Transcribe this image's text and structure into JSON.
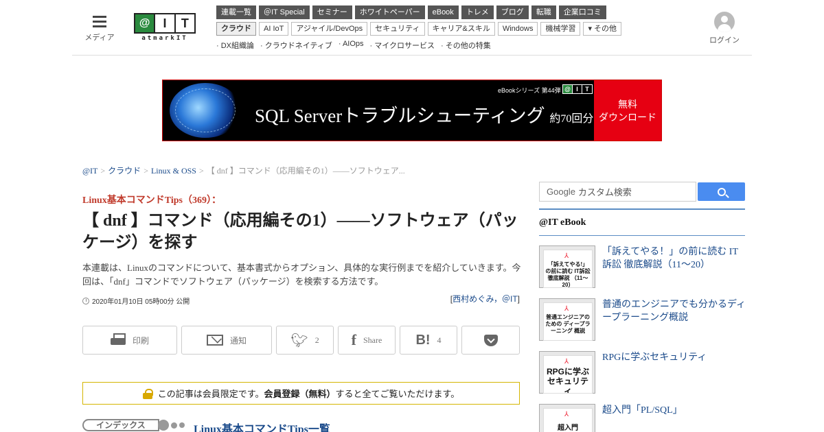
{
  "header": {
    "menu_label": "メディア",
    "logo": {
      "a": "@",
      "b": "I",
      "c": "T",
      "sub": "atmarkIT"
    },
    "login_label": "ログイン",
    "nav_primary": [
      "連載一覧",
      "＠IT Special",
      "セミナー",
      "ホワイトペーパー",
      "eBook",
      "トレメ",
      "ブログ",
      "転職",
      "企業口コミ"
    ],
    "nav_secondary": [
      "クラウド",
      "AI IoT",
      "アジャイル/DevOps",
      "セキュリティ",
      "キャリア&スキル",
      "Windows",
      "機械学習",
      "▾ その他"
    ],
    "nav_tertiary": [
      "· DX組織論",
      "· クラウドネイティブ",
      "· AIOps",
      "· マイクロサービス",
      "· その他の特集"
    ]
  },
  "banner": {
    "tag": "eBookシリーズ 第44弾",
    "title_main": "SQL Serverトラブルシューティング",
    "title_small": "約70回分",
    "cta_line1": "無料",
    "cta_line2": "ダウンロード"
  },
  "breadcrumb": {
    "items": [
      "@IT",
      "クラウド",
      "Linux & OSS"
    ],
    "current": "【 dnf 】コマンド（応用編その1）――ソフトウェア...",
    "separator": ">"
  },
  "article": {
    "series": "Linux基本コマンドTips（369）：",
    "title": "【 dnf 】コマンド（応用編その1）――ソフトウェア（パッケージ）を探す",
    "lead": "本連載は、Linuxのコマンドについて、基本書式からオプション、具体的な実行例までを紹介していきます。今回は、「dnf」コマンドでソフトウェア（パッケージ）を検索する方法です。",
    "date": "2020年01月10日 05時00分 公開",
    "author_open": "[",
    "author": "西村めぐみ，＠IT",
    "author_close": "]"
  },
  "share": {
    "print_label": "印刷",
    "notify_label": "通知",
    "twitter_count": "2",
    "facebook_label": "Share",
    "hatena_label": "B!",
    "hatena_count": "4"
  },
  "notice": {
    "pre": "この記事は会員限定です。",
    "bold": "会員登録（無料）",
    "post": "すると全てご覧いただけます。"
  },
  "index": {
    "badge": "インデックス",
    "link": "Linux基本コマンドTips一覧"
  },
  "sidebar": {
    "search_brand": "Google",
    "search_placeholder": "カスタム検索",
    "section_title": "@IT eBook",
    "ebooks": [
      {
        "title": "「訴えてやる！」の前に読む IT訴訟 徹底解説（11～20）",
        "cover": "「訴えてやる!」の前に読む IT訴訟 徹底解説 （11～20）"
      },
      {
        "title": "普通のエンジニアでも分かるディープラーニング概説",
        "cover": "普通エンジニアのための ディープラーニング 概説"
      },
      {
        "title": "RPGに学ぶセキュリティ",
        "cover": "RPGに学ぶ セキュリティ"
      },
      {
        "title": "超入門「PL/SQL」",
        "cover": "超入門"
      }
    ]
  },
  "colors": {
    "accent_red": "#c03a2b",
    "link_blue": "#1a4a8a",
    "nav_dark": "#555555",
    "logo_green": "#2a8a3e"
  }
}
